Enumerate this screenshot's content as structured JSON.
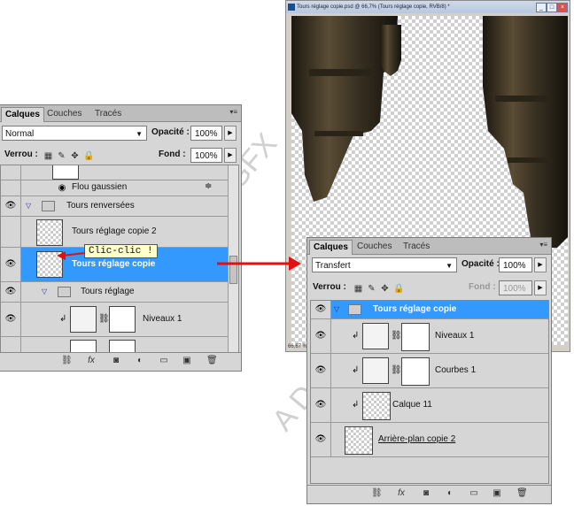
{
  "document_window": {
    "title": "Tours réglage copie.psd @ 66,7% (Tours réglage copie, RVB/8) *",
    "zoom": "66,67 %",
    "buttons": [
      "_",
      "□",
      "×"
    ]
  },
  "panel_left": {
    "tabs": [
      "Calques",
      "Couches",
      "Tracés"
    ],
    "blend_mode": "Normal",
    "opacity_label": "Opacité :",
    "opacity_value": "100%",
    "lock_label": "Verrou :",
    "fill_label": "Fond :",
    "fill_value": "100%",
    "layers": {
      "flou": "Flou gaussien",
      "group1": "Tours renversées",
      "copie2": "Tours réglage copie 2",
      "copie": "Tours réglage copie",
      "group2": "Tours réglage",
      "niveaux": "Niveaux 1"
    },
    "tooltip": "Clic-clic !"
  },
  "panel_right": {
    "tabs": [
      "Calques",
      "Couches",
      "Tracés"
    ],
    "blend_mode": "Transfert",
    "opacity_label": "Opacité :",
    "opacity_value": "100%",
    "lock_label": "Verrou :",
    "fill_label": "Fond :",
    "fill_value": "100%",
    "layers": {
      "group": "Tours réglage copie",
      "niveaux": "Niveaux 1",
      "courbes": "Courbes 1",
      "calque": "Calque 11",
      "arriere": "Arrière-plan copie 2"
    }
  },
  "watermark": "A Do Be GFX"
}
